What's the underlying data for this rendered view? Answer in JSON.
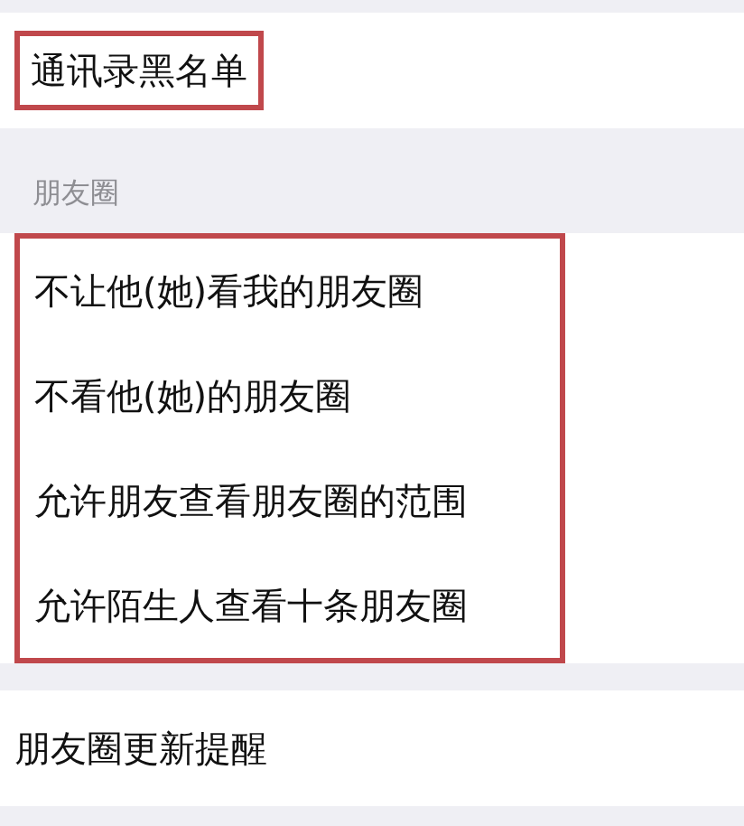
{
  "sections": [
    {
      "highlighted": false,
      "items": [
        {
          "label": "通讯录黑名单",
          "highlighted": true
        }
      ]
    },
    {
      "header": "朋友圈",
      "highlighted": true,
      "items": [
        {
          "label": "不让他(她)看我的朋友圈",
          "highlighted": false
        },
        {
          "label": "不看他(她)的朋友圈",
          "highlighted": false
        },
        {
          "label": "允许朋友查看朋友圈的范围",
          "highlighted": false
        },
        {
          "label": "允许陌生人查看十条朋友圈",
          "highlighted": false
        }
      ]
    },
    {
      "highlighted": false,
      "items": [
        {
          "label": "朋友圈更新提醒",
          "highlighted": false
        }
      ]
    }
  ]
}
